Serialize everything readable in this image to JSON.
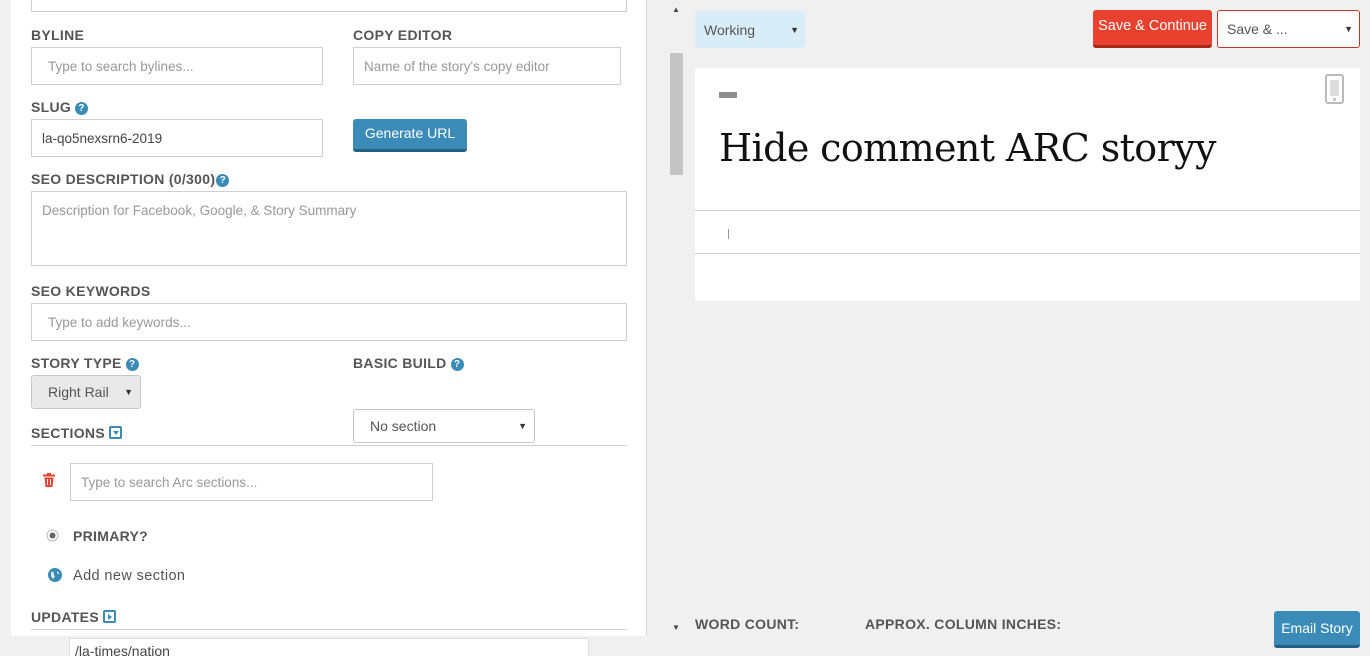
{
  "left": {
    "byline": {
      "label": "BYLINE",
      "placeholder": "Type to search bylines..."
    },
    "copy_editor": {
      "label": "COPY EDITOR",
      "placeholder": "Name of the story's copy editor"
    },
    "slug": {
      "label": "SLUG",
      "value": "la-qo5nexsrn6-2019",
      "help": "?"
    },
    "generate_url": "Generate URL",
    "seo_description": {
      "label": "SEO DESCRIPTION (0/300)",
      "placeholder": "Description for Facebook, Google, & Story Summary",
      "help": "?"
    },
    "seo_keywords": {
      "label": "SEO KEYWORDS",
      "placeholder": "Type to add keywords..."
    },
    "story_type": {
      "label": "STORY TYPE",
      "value": "Right Rail",
      "help": "?"
    },
    "basic_build": {
      "label": "BASIC BUILD",
      "value": "No section",
      "help": "?"
    },
    "sections": {
      "label": "SECTIONS",
      "search_placeholder": "Type to search Arc sections...",
      "primary_label": "PRIMARY?",
      "add_new": "Add new section"
    },
    "updates": {
      "label": "UPDATES"
    },
    "suggestion": "/la-times/nation"
  },
  "toolbar": {
    "status": "Working",
    "save_continue": "Save & Continue",
    "save_menu": "Save & ..."
  },
  "story": {
    "headline": "Hide comment ARC storyy"
  },
  "footer": {
    "word_count": "WORD COUNT:",
    "column_inches": "APPROX. COLUMN INCHES:",
    "email_story": "Email Story"
  },
  "icons": {
    "help": "question-circle-icon",
    "trash": "trash-icon",
    "radio": "radio-selected-icon",
    "globe": "globe-icon",
    "phone": "mobile-phone-icon",
    "caret": "caret-down-icon"
  },
  "colors": {
    "accent_blue": "#3a8bb7",
    "save_red": "#e8412f",
    "status_bg": "#d9edf9",
    "background": "#f0f0f0"
  }
}
